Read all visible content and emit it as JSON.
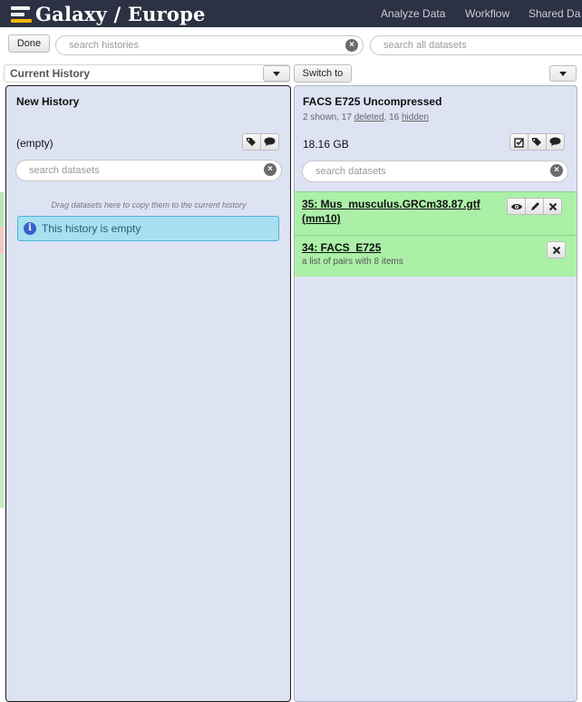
{
  "masthead": {
    "brand": "Galaxy / Europe",
    "nav": [
      "Analyze Data",
      "Workflow",
      "Shared Da"
    ]
  },
  "toolbar": {
    "done_label": "Done",
    "search_histories_placeholder": "search histories",
    "search_all_datasets_placeholder": "search all datasets"
  },
  "columns": {
    "current_label": "Current History",
    "switch_label": "Switch to"
  },
  "left_history": {
    "title": "New History",
    "size": "(empty)",
    "search_placeholder": "search datasets",
    "drag_hint": "Drag datasets here to copy them to the current history",
    "empty_message": "This history is empty"
  },
  "right_history": {
    "title": "FACS E725 Uncompressed",
    "shown_text": "2 shown, 17 ",
    "deleted_link": "deleted",
    "sep": ", 16 ",
    "hidden_link": "hidden",
    "size": "18.16 GB",
    "search_placeholder": "search datasets",
    "datasets": [
      {
        "title_line1": "35: Mus_musculus.GRCm38.87.gtf",
        "title_line2": "(mm10)",
        "subtitle": ""
      },
      {
        "title_line1": "34: FACS_E725",
        "title_line2": "",
        "subtitle": "a list of pairs with 8 items"
      }
    ]
  },
  "colors": {
    "masthead": "#2c3143",
    "panel": "#dde3f3",
    "dataset_ok": "#acf0a8",
    "info_bg": "#a8e0f2"
  }
}
